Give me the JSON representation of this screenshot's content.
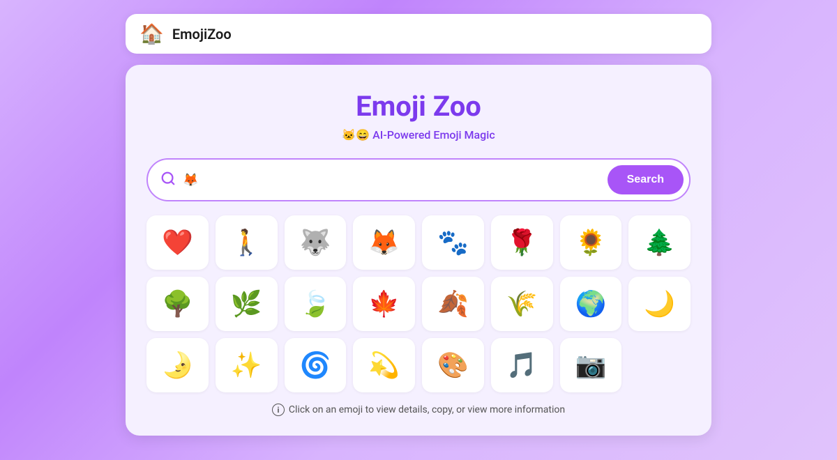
{
  "nav": {
    "logo_icon": "🏠",
    "title": "EmojiZoo"
  },
  "main": {
    "title": "Emoji Zoo",
    "subtitle_emojis": "🐱😄",
    "subtitle_text": "AI-Powered Emoji Magic",
    "search": {
      "placeholder": "🦊",
      "button_label": "Search"
    },
    "footer_text": "Click on an emoji to view details, copy, or view more information",
    "emoji_rows": [
      [
        "❤️",
        "🚶",
        "🐺",
        "🦊",
        "🐾",
        "🌹",
        "🌻",
        "🌲"
      ],
      [
        "🌳",
        "🌿",
        "🍃",
        "🍁",
        "🍂",
        "🌾",
        "🌍",
        "🌙"
      ],
      [
        "🌛",
        "✨",
        "🌀",
        "💫",
        "🎨",
        "🎵",
        "📷",
        ""
      ]
    ]
  }
}
